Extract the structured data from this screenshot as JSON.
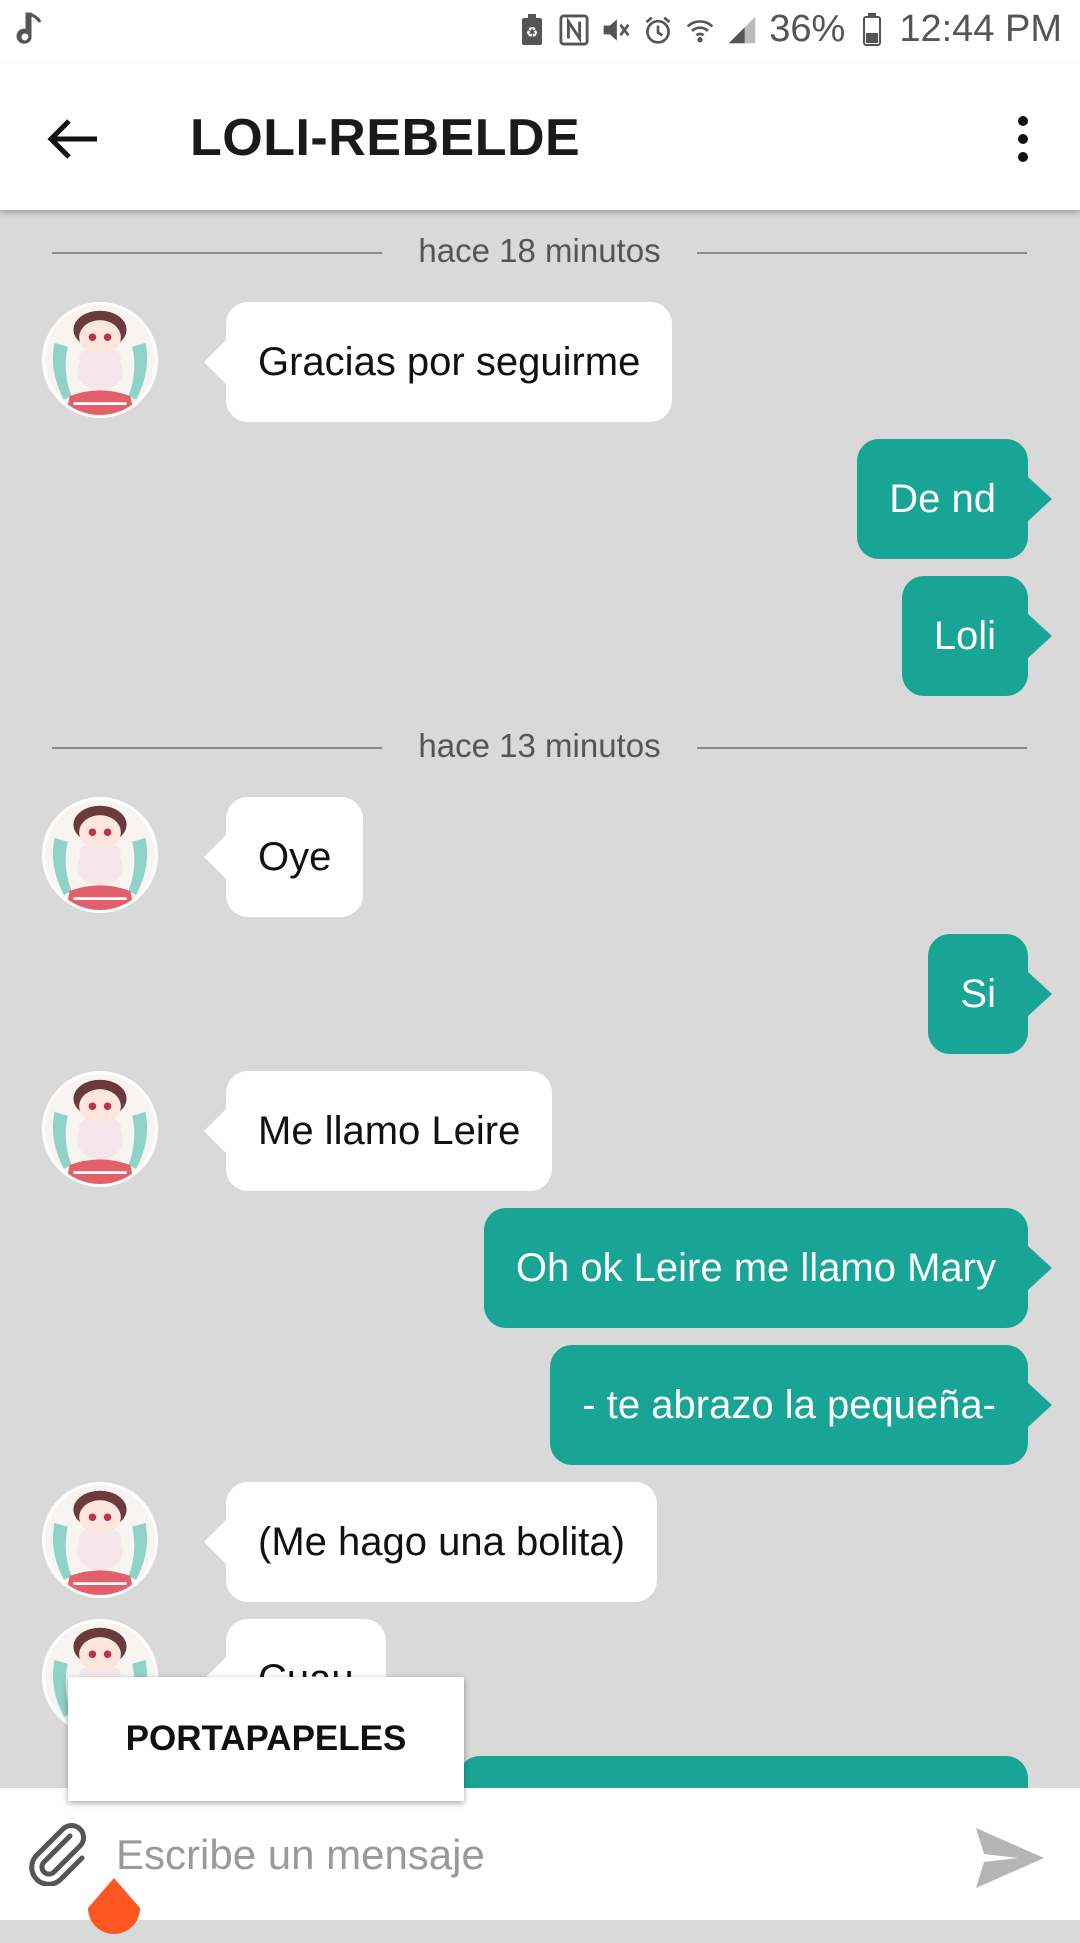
{
  "status_bar": {
    "battery": "36%",
    "time": "12:44 PM",
    "left_icon": "music-note-icon",
    "right_icons": [
      "battery-saver-icon",
      "nfc-icon",
      "mute-icon",
      "alarm-icon",
      "wifi-icon",
      "signal-icon",
      "battery-icon"
    ]
  },
  "header": {
    "title": "LOLI-REBELDE",
    "back_icon": "arrow-left-icon",
    "menu_icon": "more-vert-icon"
  },
  "chat": {
    "timestamps": [
      "hace 18 minutos",
      "hace 13 minutos"
    ],
    "messages": [
      {
        "side": "in",
        "text": "Gracias por seguirme"
      },
      {
        "side": "out",
        "text": "De nd"
      },
      {
        "side": "out",
        "text": "Loli"
      },
      {
        "side": "in",
        "text": "Oye"
      },
      {
        "side": "out",
        "text": "Si"
      },
      {
        "side": "in",
        "text": "Me llamo Leire"
      },
      {
        "side": "out",
        "text": "Oh ok Leire me llamo Mary"
      },
      {
        "side": "out",
        "text": "- te abrazo la pequeña-"
      },
      {
        "side": "in",
        "text": "(Me hago una bolita)"
      },
      {
        "side": "in",
        "text": "Cuau"
      }
    ]
  },
  "clipboard": {
    "label": "PORTAPAPELES"
  },
  "composer": {
    "placeholder": "Escribe un mensaje",
    "attach_icon": "paperclip-icon",
    "send_icon": "send-icon"
  },
  "colors": {
    "outgoing_bubble": "#18a596",
    "incoming_bubble": "#ffffff",
    "chat_background": "#d9d9d9",
    "text_handle": "#ff5722"
  }
}
